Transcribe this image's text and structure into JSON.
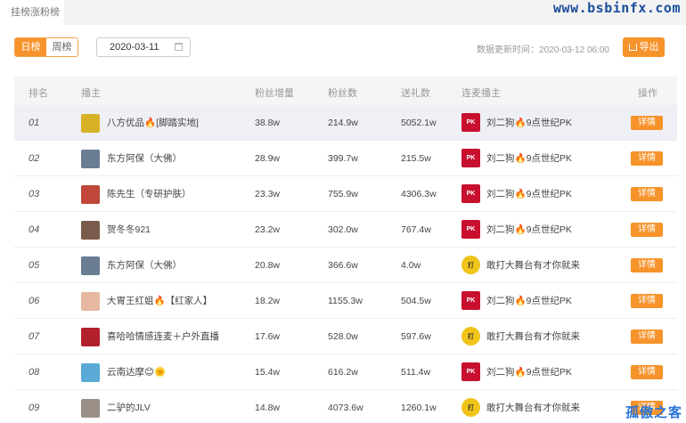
{
  "tabbar": {
    "active_tab": "挂榜涨粉榜"
  },
  "watermark": "www.bsbinfx.com",
  "toolbar": {
    "daily_label": "日榜",
    "weekly_label": "周榜",
    "date_value": "2020-03-11",
    "updated_text": "数据更新时间：2020-03-12 06:00",
    "export_label": "导出"
  },
  "table": {
    "headers": [
      "排名",
      "播主",
      "粉丝增量",
      "粉丝数",
      "送礼数",
      "连麦播主",
      "操作"
    ],
    "rows": [
      {
        "rank": "01",
        "name": "八方优品🔥[脚踏实地]",
        "fans_gain": "38.8w",
        "fans": "214.9w",
        "gifts": "5052.1w",
        "connect": "刘二狗🔥9点世纪PK",
        "connect_icon": "red",
        "action": "详情",
        "avatar_color": "#d8b226"
      },
      {
        "rank": "02",
        "name": "东方阿保（大佛）",
        "fans_gain": "28.9w",
        "fans": "399.7w",
        "gifts": "215.5w",
        "connect": "刘二狗🔥9点世纪PK",
        "connect_icon": "red",
        "action": "详情",
        "avatar_color": "#6b7d93"
      },
      {
        "rank": "03",
        "name": "陈先生（专研护肤）",
        "fans_gain": "23.3w",
        "fans": "755.9w",
        "gifts": "4306.3w",
        "connect": "刘二狗🔥9点世纪PK",
        "connect_icon": "red",
        "action": "详情",
        "avatar_color": "#c0473a"
      },
      {
        "rank": "04",
        "name": "贺冬冬921",
        "fans_gain": "23.2w",
        "fans": "302.0w",
        "gifts": "767.4w",
        "connect": "刘二狗🔥9点世纪PK",
        "connect_icon": "red",
        "action": "详情",
        "avatar_color": "#7a5a4a"
      },
      {
        "rank": "05",
        "name": "东方阿保（大佛）",
        "fans_gain": "20.8w",
        "fans": "366.6w",
        "gifts": "4.0w",
        "connect": "敢打大舞台有才你就来",
        "connect_icon": "yellow",
        "action": "详情",
        "avatar_color": "#6b7d93"
      },
      {
        "rank": "06",
        "name": "大胃王红姐🔥【红家人】",
        "fans_gain": "18.2w",
        "fans": "1155.3w",
        "gifts": "504.5w",
        "connect": "刘二狗🔥9点世纪PK",
        "connect_icon": "red",
        "action": "详情",
        "avatar_color": "#e6b8a0"
      },
      {
        "rank": "07",
        "name": "喜哈哈情感连麦＋户外直播",
        "fans_gain": "17.6w",
        "fans": "528.0w",
        "gifts": "597.6w",
        "connect": "敢打大舞台有才你就来",
        "connect_icon": "yellow",
        "action": "详情",
        "avatar_color": "#b21f2d"
      },
      {
        "rank": "08",
        "name": "云南达摩😊🌞",
        "fans_gain": "15.4w",
        "fans": "616.2w",
        "gifts": "511.4w",
        "connect": "刘二狗🔥9点世纪PK",
        "connect_icon": "red",
        "action": "详情",
        "avatar_color": "#5aa9d6"
      },
      {
        "rank": "09",
        "name": "二驴的JLV",
        "fans_gain": "14.8w",
        "fans": "4073.6w",
        "gifts": "1260.1w",
        "connect": "敢打大舞台有才你就来",
        "connect_icon": "yellow",
        "action": "详情",
        "avatar_color": "#9a8f86"
      }
    ]
  },
  "brand_watermark": "孤傲之客"
}
